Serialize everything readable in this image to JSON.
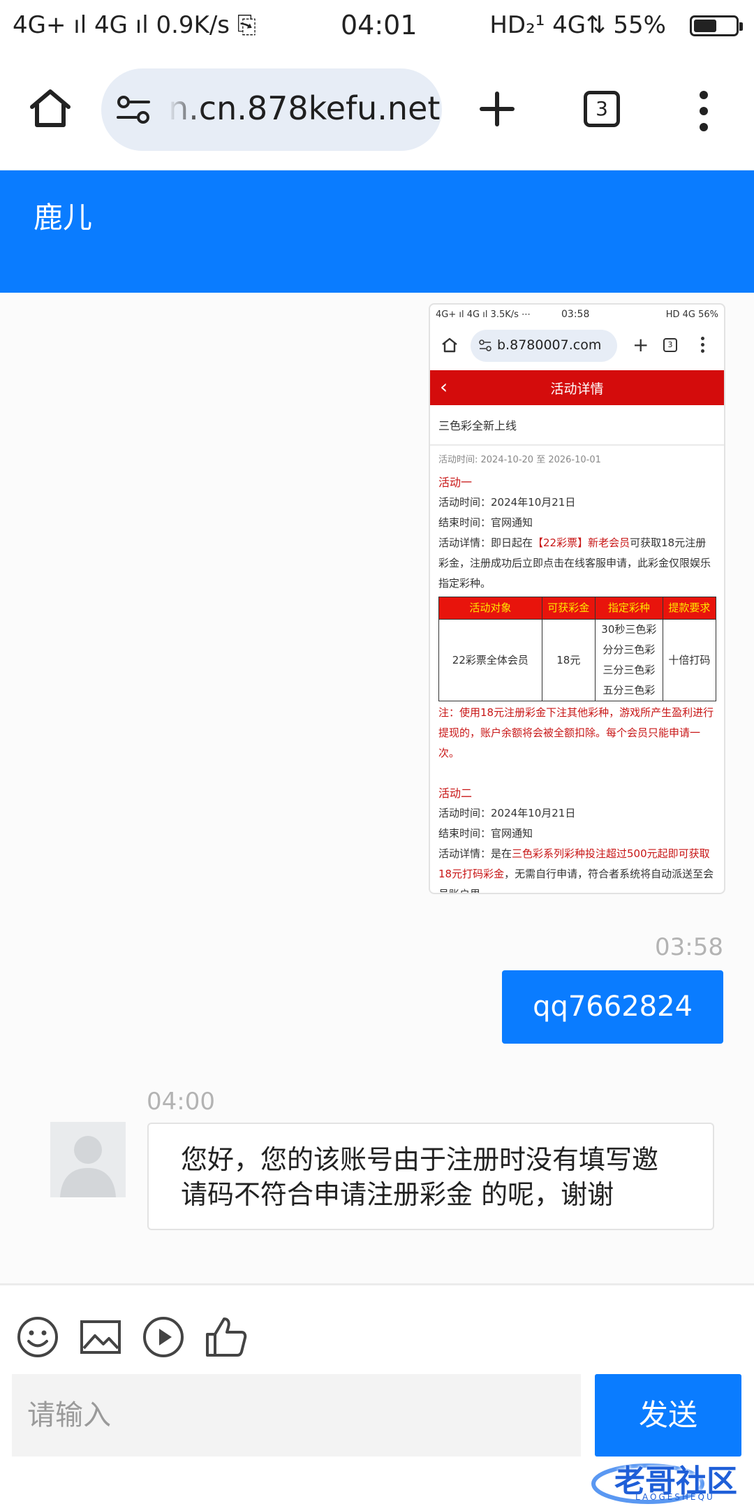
{
  "status_bar": {
    "left": "4G+ ıl  4G ıl  0.9K/s ⎘",
    "time": "04:01",
    "right": "HD₂¹ 4G⇅ 55%",
    "battery_level": 0.55
  },
  "browser": {
    "url": "n.cn.878kefu.net",
    "tab_count": "3"
  },
  "chat": {
    "title": "鹿儿"
  },
  "screenshot": {
    "status_left": "4G+ ıl 4G ıl 3.5K/s ⋯",
    "status_time": "03:58",
    "status_right": "HD 4G 56%",
    "url": "b.8780007.com",
    "tab_count": "3",
    "page_title": "活动详情",
    "back": "‹",
    "subtitle": "三色彩全新上线",
    "period": "活动时间: 2024-10-20 至 2026-10-01",
    "a1_head": "活动一",
    "a1_time": "活动时间：2024年10月21日",
    "a1_end": "结束时间：官网通知",
    "a1_detail_1": "活动详情：即日起在",
    "a1_detail_red": "【22彩票】新老会员",
    "a1_detail_2": "可获取18元注册彩金，注册成功后立即点击在线客服申请，此彩金仅限娱乐指定彩种。",
    "table_headers": [
      "活动对象",
      "可获彩金",
      "指定彩种",
      "提款要求"
    ],
    "table_target": "22彩票全体会员",
    "table_bonus": "18元",
    "table_games": [
      "30秒三色彩",
      "分分三色彩",
      "三分三色彩",
      "五分三色彩"
    ],
    "table_req": "十倍打码",
    "note": "注：使用18元注册彩金下注其他彩种，游戏所产生盈利进行提现的，账户余额将会被全额扣除。每个会员只能申请一次。",
    "a2_head": "活动二",
    "a2_time": "活动时间：2024年10月21日",
    "a2_end": "结束时间：官网通知",
    "a2_detail_1": "活动详情：是在",
    "a2_detail_red": "三色彩系列彩种投注超过500元起即可获取18元打码彩金",
    "a2_detail_2": "，无需自行申请，符合者系统将自动派送至会员账户里。"
  },
  "messages": {
    "out_time": "03:58",
    "out_text": "qq7662824",
    "in_time": "04:00",
    "in_text": "您好，您的该账号由于注册时没有填写邀请码不符合申请注册彩金 的呢，谢谢"
  },
  "composer": {
    "placeholder": "请输入",
    "send_label": "发送",
    "icons": [
      "smiley-icon",
      "image-icon",
      "video-icon",
      "thumbs-up-icon"
    ]
  },
  "watermark": {
    "text": "老哥社区",
    "sub": "LAOGESHEQU"
  },
  "colors": {
    "brand_blue": "#0a7cff",
    "promo_red": "#d40c0c"
  }
}
